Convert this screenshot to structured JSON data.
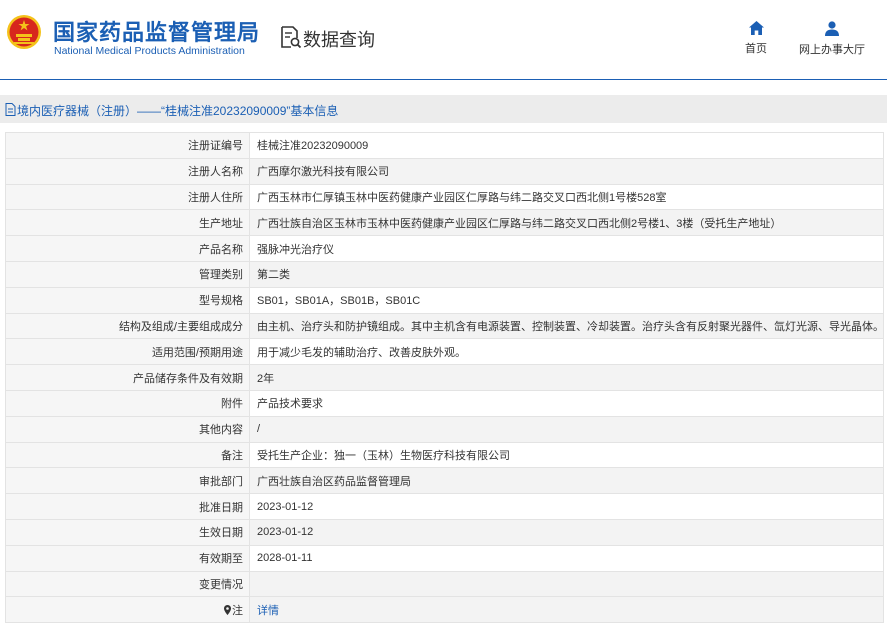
{
  "header": {
    "site_name_cn": "国家药品监督管理局",
    "site_name_en": "National Medical Products Administration",
    "query_title": "数据查询",
    "nav": [
      {
        "label": "首页",
        "icon": "home-icon"
      },
      {
        "label": "网上办事大厅",
        "icon": "user-icon"
      }
    ]
  },
  "breadcrumb": "境内医疗器械（注册）——“桂械注准20232090009”基本信息",
  "colors": {
    "brand_blue": "#1b5fb4",
    "emblem_red": "#d7261d",
    "emblem_gold": "#f4c21a"
  },
  "record": {
    "rows": [
      {
        "label": "注册证编号",
        "value": "桂械注准20232090009"
      },
      {
        "label": "注册人名称",
        "value": "广西摩尔激光科技有限公司"
      },
      {
        "label": "注册人住所",
        "value": "广西玉林市仁厚镇玉林中医药健康产业园区仁厚路与纬二路交叉口西北侧1号楼528室"
      },
      {
        "label": "生产地址",
        "value": "广西壮族自治区玉林市玉林中医药健康产业园区仁厚路与纬二路交叉口西北侧2号楼1、3楼（受托生产地址）"
      },
      {
        "label": "产品名称",
        "value": "强脉冲光治疗仪"
      },
      {
        "label": "管理类别",
        "value": "第二类"
      },
      {
        "label": "型号规格",
        "value": "SB01，SB01A，SB01B，SB01C"
      },
      {
        "label": "结构及组成/主要组成成分",
        "value": "由主机、治疗头和防护镜组成。其中主机含有电源装置、控制装置、冷却装置。治疗头含有反射聚光器件、氙灯光源、导光晶体。"
      },
      {
        "label": "适用范围/预期用途",
        "value": "用于减少毛发的辅助治疗、改善皮肤外观。"
      },
      {
        "label": "产品储存条件及有效期",
        "value": "2年"
      },
      {
        "label": "附件",
        "value": "产品技术要求"
      },
      {
        "label": "其他内容",
        "value": "/"
      },
      {
        "label": "备注",
        "value": "受托生产企业：独一（玉林）生物医疗科技有限公司"
      },
      {
        "label": "审批部门",
        "value": "广西壮族自治区药品监督管理局"
      },
      {
        "label": "批准日期",
        "value": "2023-01-12"
      },
      {
        "label": "生效日期",
        "value": "2023-01-12"
      },
      {
        "label": "有效期至",
        "value": "2028-01-11"
      },
      {
        "label": "变更情况",
        "value": ""
      }
    ],
    "note": {
      "label": "注",
      "value": "详情"
    }
  }
}
